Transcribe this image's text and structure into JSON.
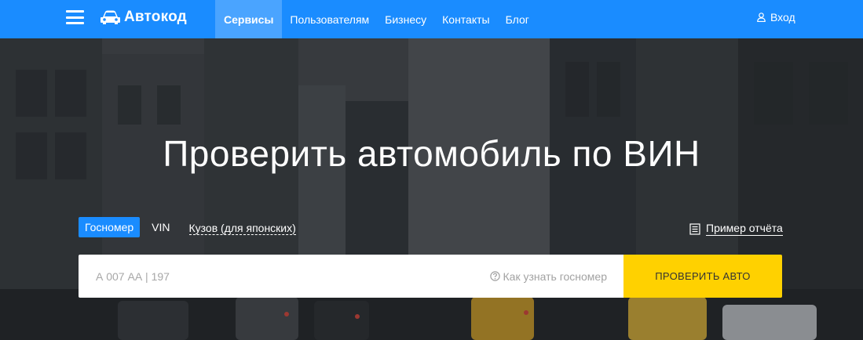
{
  "header": {
    "logo_text": "Автокод",
    "nav": [
      {
        "label": "Сервисы",
        "active": true
      },
      {
        "label": "Пользователям",
        "active": false
      },
      {
        "label": "Бизнесу",
        "active": false
      },
      {
        "label": "Контакты",
        "active": false
      },
      {
        "label": "Блог",
        "active": false
      }
    ],
    "login_label": "Вход",
    "menu_icon": "hamburger-icon",
    "logo_icon": "car-icon",
    "user_icon": "user-icon"
  },
  "hero": {
    "title": "Проверить автомобиль по ВИН"
  },
  "search": {
    "tabs": [
      {
        "label": "Госномер",
        "active": true
      },
      {
        "label": "VIN",
        "active": false
      },
      {
        "label": "Кузов (для японских)",
        "active": false
      }
    ],
    "sample_report_label": "Пример отчёта",
    "sample_icon": "document-icon",
    "input_placeholder": "А 007 АА | 197",
    "help_label": "Как узнать госномер",
    "help_icon": "question-circle-icon",
    "submit_label": "ПРОВЕРИТЬ АВТО"
  },
  "colors": {
    "header_bg": "#1a8cff",
    "active_nav_bg": "#4aa4ff",
    "submit_bg": "#ffd100",
    "active_tab_bg": "#1a8cff"
  }
}
